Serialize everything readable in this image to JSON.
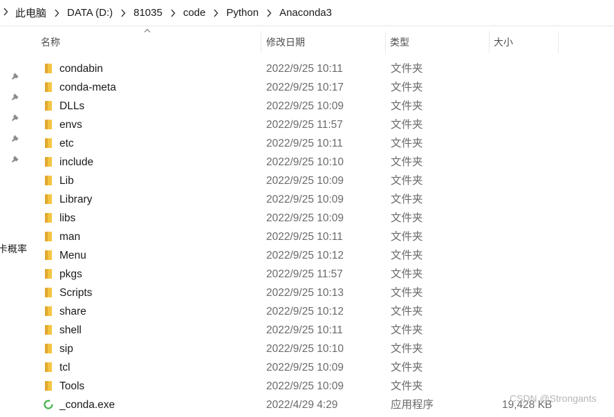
{
  "breadcrumb": [
    "此电脑",
    "DATA (D:)",
    "81035",
    "code",
    "Python",
    "Anaconda3"
  ],
  "columns": {
    "name": "名称",
    "date": "修改日期",
    "type": "类型",
    "size": "大小"
  },
  "sidebar": {
    "partial_label": "卡概率"
  },
  "files": [
    {
      "name": "condabin",
      "date": "2022/9/25 10:11",
      "type": "文件夹",
      "size": "",
      "icon": "folder-icon"
    },
    {
      "name": "conda-meta",
      "date": "2022/9/25 10:17",
      "type": "文件夹",
      "size": "",
      "icon": "folder-icon"
    },
    {
      "name": "DLLs",
      "date": "2022/9/25 10:09",
      "type": "文件夹",
      "size": "",
      "icon": "folder-icon"
    },
    {
      "name": "envs",
      "date": "2022/9/25 11:57",
      "type": "文件夹",
      "size": "",
      "icon": "folder-icon"
    },
    {
      "name": "etc",
      "date": "2022/9/25 10:11",
      "type": "文件夹",
      "size": "",
      "icon": "folder-icon"
    },
    {
      "name": "include",
      "date": "2022/9/25 10:10",
      "type": "文件夹",
      "size": "",
      "icon": "folder-icon"
    },
    {
      "name": "Lib",
      "date": "2022/9/25 10:09",
      "type": "文件夹",
      "size": "",
      "icon": "folder-icon"
    },
    {
      "name": "Library",
      "date": "2022/9/25 10:09",
      "type": "文件夹",
      "size": "",
      "icon": "folder-icon"
    },
    {
      "name": "libs",
      "date": "2022/9/25 10:09",
      "type": "文件夹",
      "size": "",
      "icon": "folder-icon"
    },
    {
      "name": "man",
      "date": "2022/9/25 10:11",
      "type": "文件夹",
      "size": "",
      "icon": "folder-icon"
    },
    {
      "name": "Menu",
      "date": "2022/9/25 10:12",
      "type": "文件夹",
      "size": "",
      "icon": "folder-icon"
    },
    {
      "name": "pkgs",
      "date": "2022/9/25 11:57",
      "type": "文件夹",
      "size": "",
      "icon": "folder-icon"
    },
    {
      "name": "Scripts",
      "date": "2022/9/25 10:13",
      "type": "文件夹",
      "size": "",
      "icon": "folder-icon"
    },
    {
      "name": "share",
      "date": "2022/9/25 10:12",
      "type": "文件夹",
      "size": "",
      "icon": "folder-icon"
    },
    {
      "name": "shell",
      "date": "2022/9/25 10:11",
      "type": "文件夹",
      "size": "",
      "icon": "folder-icon"
    },
    {
      "name": "sip",
      "date": "2022/9/25 10:10",
      "type": "文件夹",
      "size": "",
      "icon": "folder-icon"
    },
    {
      "name": "tcl",
      "date": "2022/9/25 10:09",
      "type": "文件夹",
      "size": "",
      "icon": "folder-icon"
    },
    {
      "name": "Tools",
      "date": "2022/9/25 10:09",
      "type": "文件夹",
      "size": "",
      "icon": "folder-icon"
    },
    {
      "name": "_conda.exe",
      "date": "2022/4/29 4:29",
      "type": "应用程序",
      "size": "19,428 KB",
      "icon": "conda-exe-icon"
    }
  ],
  "watermark": "CSDN @Strongants",
  "colors": {
    "folder": "#f4c542",
    "folder_dark": "#e0a82e",
    "exe": "#43b049",
    "pin": "#8a8a8a"
  }
}
